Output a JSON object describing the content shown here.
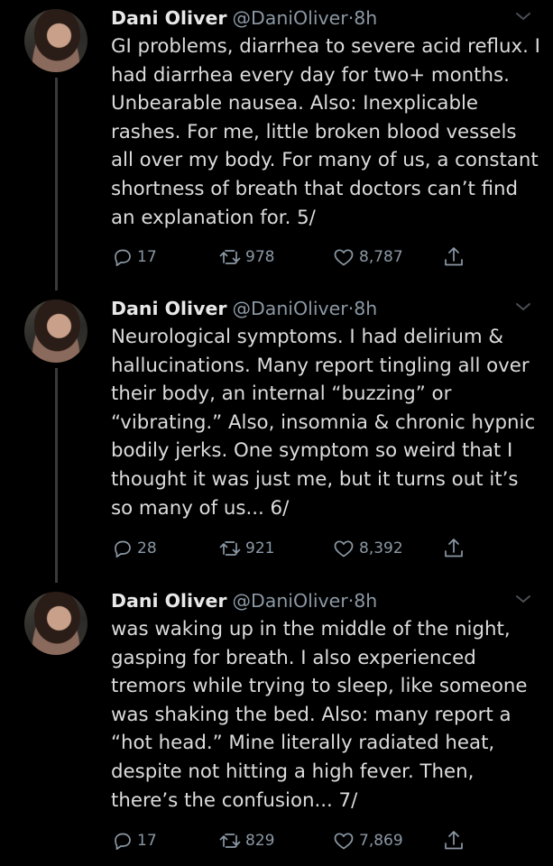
{
  "tweets": [
    {
      "author_name": "Dani Oliver",
      "handle": "@DaniOliver",
      "separator": "·",
      "time": "8h",
      "text": "GI problems, diarrhea to severe acid reflux. I had diarrhea every day for two+ months. Unbearable nausea. Also: Inexplicable rashes. For me, little broken blood vessels all over my body. For many of us, a constant shortness of breath that doctors can’t find an explanation for. 5/",
      "replies": "17",
      "retweets": "978",
      "likes": "8,787"
    },
    {
      "author_name": "Dani Oliver",
      "handle": "@DaniOliver",
      "separator": "·",
      "time": "8h",
      "text": "Neurological symptoms. I had delirium & hallucinations. Many report tingling all over their body, an internal “buzzing” or “vibrating.” Also, insomnia & chronic hypnic bodily jerks. One symptom so weird that I thought it was just me, but it turns out it’s so many of us... 6/",
      "replies": "28",
      "retweets": "921",
      "likes": "8,392"
    },
    {
      "author_name": "Dani Oliver",
      "handle": "@DaniOliver",
      "separator": "·",
      "time": "8h",
      "text": "was waking up in the middle of the night, gasping for breath. I also experienced tremors while trying to sleep, like someone was shaking the bed. Also: many report a “hot head.” Mine literally radiated heat, despite not hitting a high fever. Then, there’s the confusion... 7/",
      "replies": "17",
      "retweets": "829",
      "likes": "7,869"
    }
  ],
  "icons": {
    "reply": "reply-icon",
    "retweet": "retweet-icon",
    "like": "heart-icon",
    "share": "share-icon",
    "menu": "chevron-down-icon"
  },
  "colors": {
    "background": "#000000",
    "text": "#dcdcdc",
    "secondary": "#8b98a5",
    "thread_line": "#3a3a3a"
  }
}
